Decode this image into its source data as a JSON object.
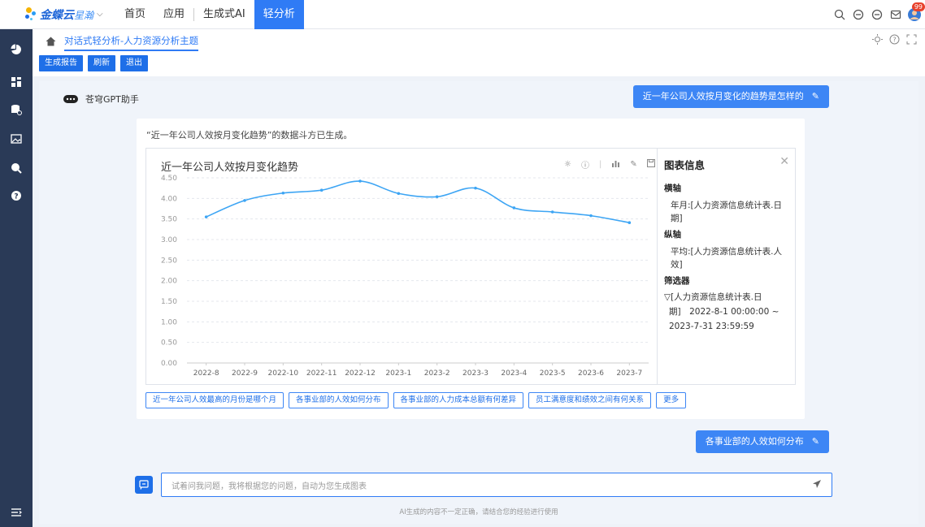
{
  "app": {
    "logo_main": "金蝶云",
    "logo_sub": "星瀚",
    "notification_count": "99"
  },
  "nav": {
    "items": [
      "首页",
      "应用",
      "生成式AI",
      "轻分析"
    ],
    "active_index": 3
  },
  "breadcrumb": {
    "label": "对话式轻分析-人力资源分析主题"
  },
  "toolbar": {
    "buttons": [
      "生成报告",
      "刷新",
      "退出"
    ]
  },
  "assistant": {
    "name": "苍穹GPT助手"
  },
  "messages": {
    "question_1": "近一年公司人效按月变化的趋势是怎样的",
    "question_2": "各事业部的人效如何分布",
    "reply_intro": "“近一年公司人效按月变化趋势”的数据斗方已生成。"
  },
  "chart_data": {
    "type": "line",
    "title": "近一年公司人效按月变化趋势",
    "x": [
      "2022-8",
      "2022-9",
      "2022-10",
      "2022-11",
      "2022-12",
      "2023-1",
      "2023-2",
      "2023-3",
      "2023-4",
      "2023-5",
      "2023-6",
      "2023-7"
    ],
    "series": [
      {
        "values": [
          3.55,
          3.95,
          4.13,
          4.2,
          4.42,
          4.12,
          4.04,
          4.25,
          3.77,
          3.67,
          3.58,
          3.41
        ]
      }
    ],
    "yticks": [
      "0.00",
      "0.50",
      "1.00",
      "1.50",
      "2.00",
      "2.50",
      "3.00",
      "3.50",
      "4.00",
      "4.50"
    ],
    "ylim": [
      0,
      4.5
    ],
    "grid": true,
    "line_color": "#3da5f4"
  },
  "chart_info": {
    "title": "图表信息",
    "x_axis_label": "横轴",
    "x_axis_value": "年月:[人力资源信息统计表.日期]",
    "y_axis_label": "纵轴",
    "y_axis_value": "平均:[人力资源信息统计表.人效]",
    "filter_label": "筛选器",
    "filter_value_1": "▽[人力资源信息统计表.日",
    "filter_value_2": "期]　2022-8-1 00:00:00 ~",
    "filter_value_3": "2023-7-31 23:59:59"
  },
  "suggestions": [
    "近一年公司人效最高的月份是哪个月",
    "各事业部的人效如何分布",
    "各事业部的人力成本总额有何差异",
    "员工满意度和绩效之间有何关系",
    "更多"
  ],
  "input": {
    "placeholder": "试着问我问题，我将根据您的问题，自动为您生成图表"
  },
  "disclaimer": "AI生成的内容不一定正确，请结合您的经验进行使用"
}
